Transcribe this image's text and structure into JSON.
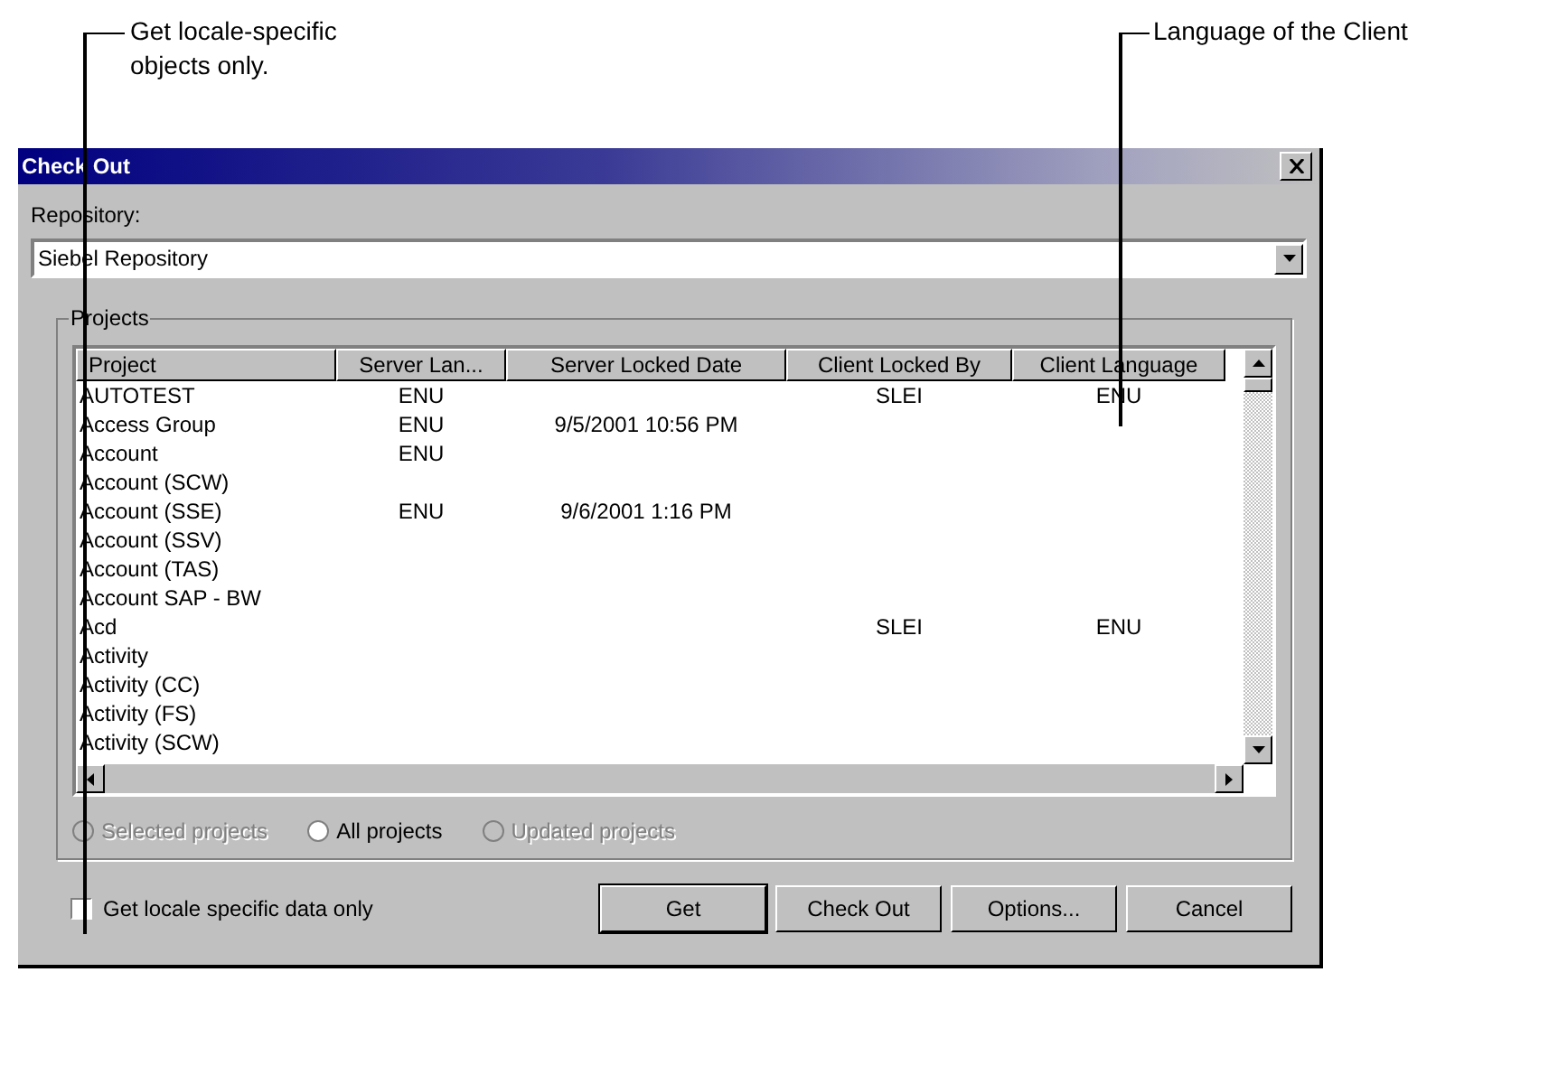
{
  "callouts": [
    {
      "text": "Get locale-specific objects only."
    },
    {
      "text": "Language of the Client"
    }
  ],
  "window": {
    "title": "Check Out"
  },
  "repository": {
    "label": "Repository:",
    "value": "Siebel Repository"
  },
  "projects": {
    "title": "Projects",
    "table": {
      "columns": [
        "Project",
        "Server Lan...",
        "Server Locked Date",
        "Client Locked By",
        "Client Language"
      ],
      "rows": [
        [
          "AUTOTEST",
          "ENU",
          "",
          "SLEI",
          "ENU"
        ],
        [
          "Access Group",
          "ENU",
          "9/5/2001 10:56 PM",
          "",
          ""
        ],
        [
          "Account",
          "ENU",
          "",
          "",
          ""
        ],
        [
          "Account (SCW)",
          "",
          "",
          "",
          ""
        ],
        [
          "Account (SSE)",
          "ENU",
          "9/6/2001 1:16 PM",
          "",
          ""
        ],
        [
          "Account (SSV)",
          "",
          "",
          "",
          ""
        ],
        [
          "Account (TAS)",
          "",
          "",
          "",
          ""
        ],
        [
          "Account SAP - BW",
          "",
          "",
          "",
          ""
        ],
        [
          "Acd",
          "",
          "",
          "SLEI",
          "ENU"
        ],
        [
          "Activity",
          "",
          "",
          "",
          ""
        ],
        [
          "Activity (CC)",
          "",
          "",
          "",
          ""
        ],
        [
          "Activity (FS)",
          "",
          "",
          "",
          ""
        ],
        [
          "Activity (SCW)",
          "",
          "",
          "",
          ""
        ]
      ]
    },
    "radios": [
      {
        "label": "Selected projects",
        "selected": false,
        "disabled": true
      },
      {
        "label": "All projects",
        "selected": false,
        "disabled": false
      },
      {
        "label": "Updated projects",
        "selected": false,
        "disabled": true
      }
    ]
  },
  "locale_checkbox": {
    "label": "Get locale specific data only",
    "checked": false
  },
  "buttons": [
    "Get",
    "Check Out",
    "Options...",
    "Cancel"
  ]
}
